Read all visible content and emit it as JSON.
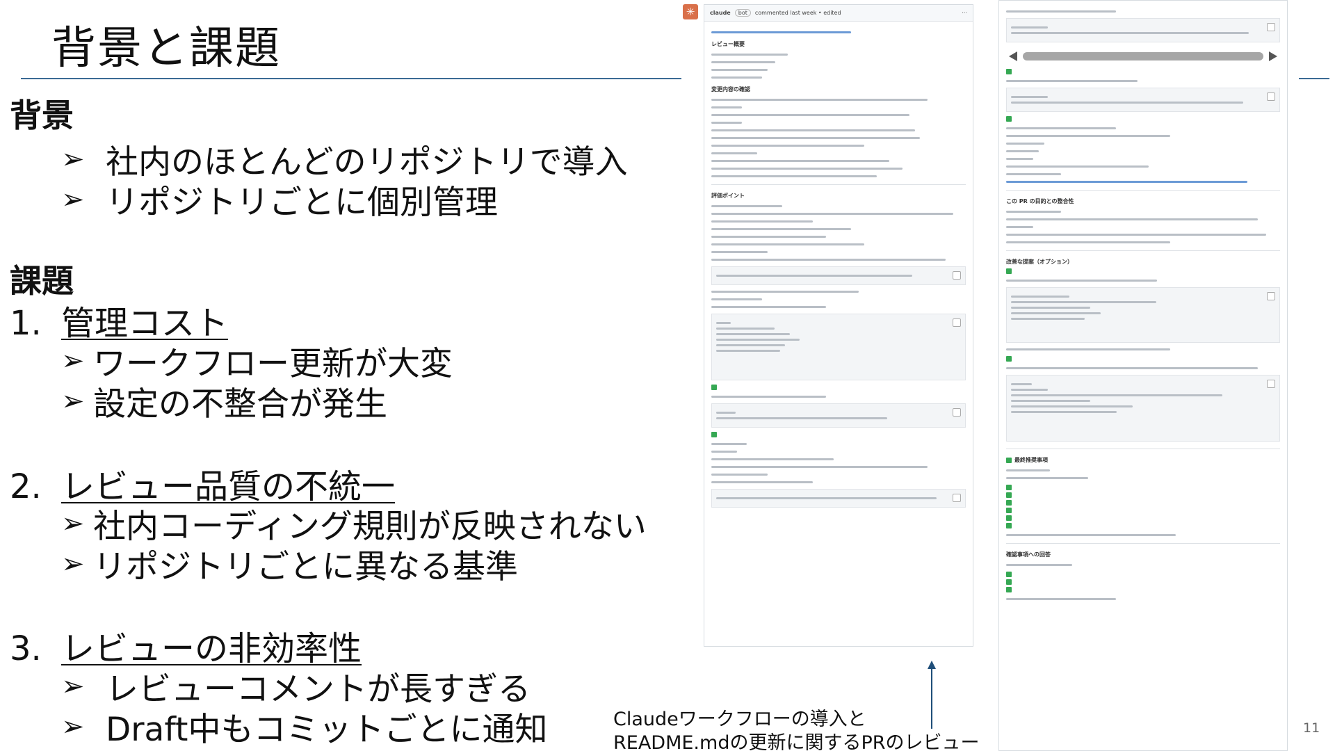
{
  "slide": {
    "title": "背景と課題",
    "page_number": "11"
  },
  "background": {
    "heading": "背景",
    "bullets": [
      "社内のほとんどのリポジトリで導入",
      "リポジトリごとに個別管理"
    ]
  },
  "issues": {
    "heading": "課題",
    "items": [
      {
        "number": "1.",
        "title": "管理コスト",
        "bullets": [
          "ワークフロー更新が大変",
          "設定の不整合が発生"
        ]
      },
      {
        "number": "2.",
        "title": "レビュー品質の不統一",
        "bullets": [
          "社内コーディング規則が反映されない",
          "リポジトリごとに異なる基準"
        ]
      },
      {
        "number": "3.",
        "title": "レビューの非効率性",
        "bullets": [
          "レビューコメントが長すぎる",
          "Draft中もコミットごとに通知"
        ]
      }
    ]
  },
  "bullet_glyph": "➢",
  "screenshot": {
    "left_panel": {
      "author": "claude",
      "badge": "bot",
      "meta": "commented last week • edited",
      "headings": [
        "レビュー概要",
        "変更内容の確認",
        "評価ポイント"
      ]
    },
    "right_panel": {
      "headings": [
        "この PR の目的との整合性",
        "改善な提案（オプション）",
        "最終推奨事項",
        "確認事項への回答"
      ]
    },
    "caption_lines": [
      "Claudeワークフローの導入と",
      "README.mdの更新に関するPRのレビュー"
    ]
  },
  "colors": {
    "rule": "#3b6b95",
    "arrow": "#1f4e79",
    "check": "#35a853",
    "logo": "#d9704a"
  }
}
